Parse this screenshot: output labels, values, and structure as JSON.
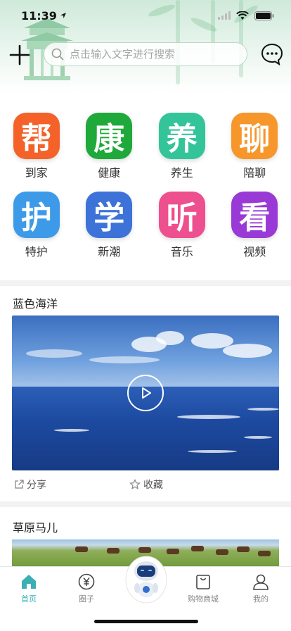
{
  "status": {
    "time": "11:39"
  },
  "search": {
    "placeholder": "点击输入文字进行搜索"
  },
  "grid": [
    {
      "glyph": "帮",
      "label": "到家",
      "color": "#f4622a"
    },
    {
      "glyph": "康",
      "label": "健康",
      "color": "#1fa93b"
    },
    {
      "glyph": "养",
      "label": "养生",
      "color": "#33c49a"
    },
    {
      "glyph": "聊",
      "label": "陪聊",
      "color": "#f6962b"
    },
    {
      "glyph": "护",
      "label": "特护",
      "color": "#3d9ae8"
    },
    {
      "glyph": "学",
      "label": "新潮",
      "color": "#3d73d8"
    },
    {
      "glyph": "听",
      "label": "音乐",
      "color": "#ee4f8e"
    },
    {
      "glyph": "看",
      "label": "视频",
      "color": "#9a3ad6"
    }
  ],
  "cards": [
    {
      "title": "蓝色海洋",
      "share_label": "分享",
      "favorite_label": "收藏"
    },
    {
      "title": "草原马儿"
    }
  ],
  "tabbar": {
    "items": [
      {
        "label": "首页",
        "icon": "home-icon",
        "active": true
      },
      {
        "label": "圈子",
        "icon": "yen-circle-icon"
      },
      {
        "label": "购物商城",
        "icon": "shopping-bag-icon"
      },
      {
        "label": "我的",
        "icon": "user-icon"
      }
    ],
    "active_color": "#3ab0b5"
  }
}
